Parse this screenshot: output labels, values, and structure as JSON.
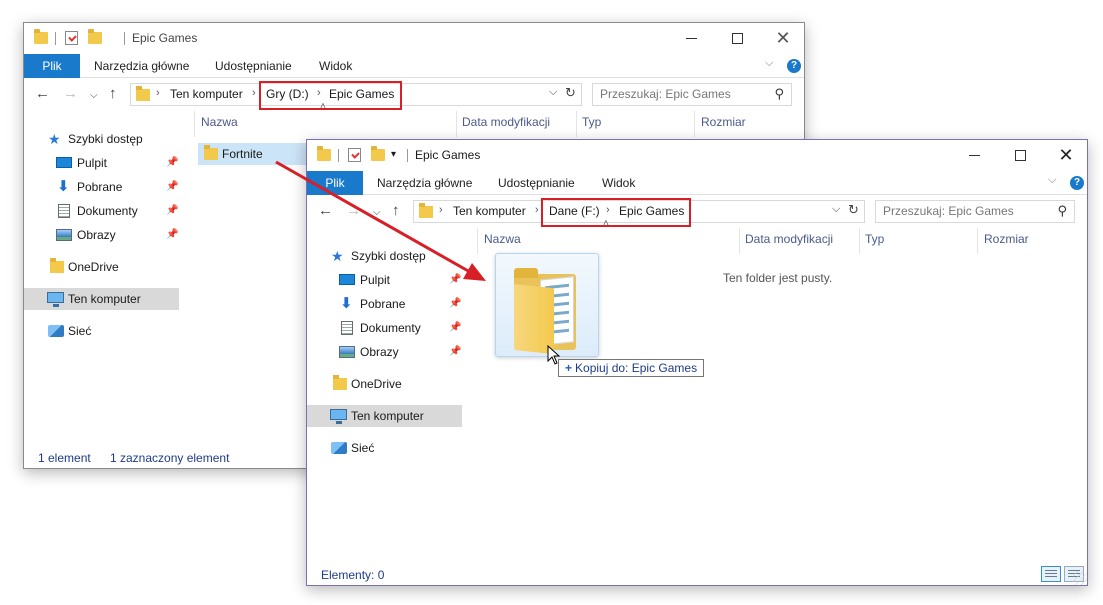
{
  "back_window": {
    "title": "Epic Games",
    "ribbon": {
      "file": "Plik",
      "home": "Narzędzia główne",
      "share": "Udostępnianie",
      "view": "Widok"
    },
    "address": {
      "computer": "Ten komputer",
      "drive": "Gry (D:)",
      "folder": "Epic Games"
    },
    "search_placeholder": "Przeszukaj: Epic Games",
    "columns": {
      "name": "Nazwa",
      "date": "Data modyfikacji",
      "type": "Typ",
      "size": "Rozmiar"
    },
    "nav": {
      "quick_access": "Szybki dostęp",
      "desktop": "Pulpit",
      "downloads": "Pobrane",
      "documents": "Dokumenty",
      "pictures": "Obrazy",
      "onedrive": "OneDrive",
      "this_pc": "Ten komputer",
      "network": "Sieć"
    },
    "files": [
      {
        "name": "Fortnite"
      }
    ],
    "status": {
      "count": "1 element",
      "selected": "1 zaznaczony element"
    }
  },
  "front_window": {
    "title": "Epic Games",
    "ribbon": {
      "file": "Plik",
      "home": "Narzędzia główne",
      "share": "Udostępnianie",
      "view": "Widok"
    },
    "address": {
      "computer": "Ten komputer",
      "drive": "Dane (F:)",
      "folder": "Epic Games"
    },
    "search_placeholder": "Przeszukaj: Epic Games",
    "columns": {
      "name": "Nazwa",
      "date": "Data modyfikacji",
      "type": "Typ",
      "size": "Rozmiar"
    },
    "nav": {
      "quick_access": "Szybki dostęp",
      "desktop": "Pulpit",
      "downloads": "Pobrane",
      "documents": "Dokumenty",
      "pictures": "Obrazy",
      "onedrive": "OneDrive",
      "this_pc": "Ten komputer",
      "network": "Sieć"
    },
    "empty_message": "Ten folder jest pusty.",
    "drag_tooltip": "Kopiuj do: Epic Games",
    "status": {
      "count": "Elementy: 0"
    }
  },
  "colors": {
    "accent": "#1979ca",
    "highlight_box": "#d81f26",
    "selection": "#cce4f7"
  }
}
